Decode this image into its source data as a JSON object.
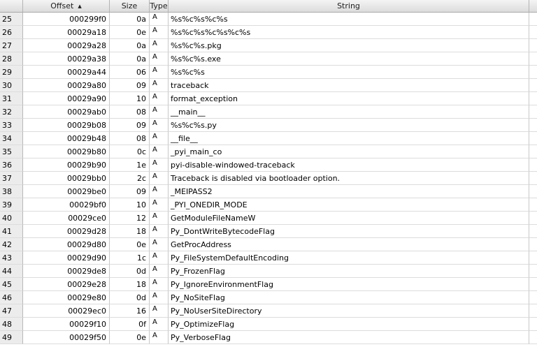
{
  "columns": {
    "index": "",
    "offset": "Offset",
    "size": "Size",
    "type": "Type",
    "string": "String"
  },
  "sort": {
    "column": "offset",
    "icon": "sort-ascending-icon"
  },
  "rows": [
    {
      "idx": "25",
      "offset": "000299f0",
      "size": "0a",
      "type": "A",
      "string": "%s%c%s%c%s"
    },
    {
      "idx": "26",
      "offset": "00029a18",
      "size": "0e",
      "type": "A",
      "string": "%s%c%s%c%s%c%s"
    },
    {
      "idx": "27",
      "offset": "00029a28",
      "size": "0a",
      "type": "A",
      "string": "%s%c%s.pkg"
    },
    {
      "idx": "28",
      "offset": "00029a38",
      "size": "0a",
      "type": "A",
      "string": "%s%c%s.exe"
    },
    {
      "idx": "29",
      "offset": "00029a44",
      "size": "06",
      "type": "A",
      "string": "%s%c%s"
    },
    {
      "idx": "30",
      "offset": "00029a80",
      "size": "09",
      "type": "A",
      "string": "traceback"
    },
    {
      "idx": "31",
      "offset": "00029a90",
      "size": "10",
      "type": "A",
      "string": "format_exception"
    },
    {
      "idx": "32",
      "offset": "00029ab0",
      "size": "08",
      "type": "A",
      "string": "__main__"
    },
    {
      "idx": "33",
      "offset": "00029b08",
      "size": "09",
      "type": "A",
      "string": "%s%c%s.py"
    },
    {
      "idx": "34",
      "offset": "00029b48",
      "size": "08",
      "type": "A",
      "string": "__file__"
    },
    {
      "idx": "35",
      "offset": "00029b80",
      "size": "0c",
      "type": "A",
      "string": "_pyi_main_co"
    },
    {
      "idx": "36",
      "offset": "00029b90",
      "size": "1e",
      "type": "A",
      "string": "pyi-disable-windowed-traceback"
    },
    {
      "idx": "37",
      "offset": "00029bb0",
      "size": "2c",
      "type": "A",
      "string": "Traceback is disabled via bootloader option."
    },
    {
      "idx": "38",
      "offset": "00029be0",
      "size": "09",
      "type": "A",
      "string": "_MEIPASS2"
    },
    {
      "idx": "39",
      "offset": "00029bf0",
      "size": "10",
      "type": "A",
      "string": "_PYI_ONEDIR_MODE"
    },
    {
      "idx": "40",
      "offset": "00029ce0",
      "size": "12",
      "type": "A",
      "string": "GetModuleFileNameW"
    },
    {
      "idx": "41",
      "offset": "00029d28",
      "size": "18",
      "type": "A",
      "string": "Py_DontWriteBytecodeFlag"
    },
    {
      "idx": "42",
      "offset": "00029d80",
      "size": "0e",
      "type": "A",
      "string": "GetProcAddress"
    },
    {
      "idx": "43",
      "offset": "00029d90",
      "size": "1c",
      "type": "A",
      "string": "Py_FileSystemDefaultEncoding"
    },
    {
      "idx": "44",
      "offset": "00029de8",
      "size": "0d",
      "type": "A",
      "string": "Py_FrozenFlag"
    },
    {
      "idx": "45",
      "offset": "00029e28",
      "size": "18",
      "type": "A",
      "string": "Py_IgnoreEnvironmentFlag"
    },
    {
      "idx": "46",
      "offset": "00029e80",
      "size": "0d",
      "type": "A",
      "string": "Py_NoSiteFlag"
    },
    {
      "idx": "47",
      "offset": "00029ec0",
      "size": "16",
      "type": "A",
      "string": "Py_NoUserSiteDirectory"
    },
    {
      "idx": "48",
      "offset": "00029f10",
      "size": "0f",
      "type": "A",
      "string": "Py_OptimizeFlag"
    },
    {
      "idx": "49",
      "offset": "00029f50",
      "size": "0e",
      "type": "A",
      "string": "Py_VerboseFlag"
    }
  ]
}
